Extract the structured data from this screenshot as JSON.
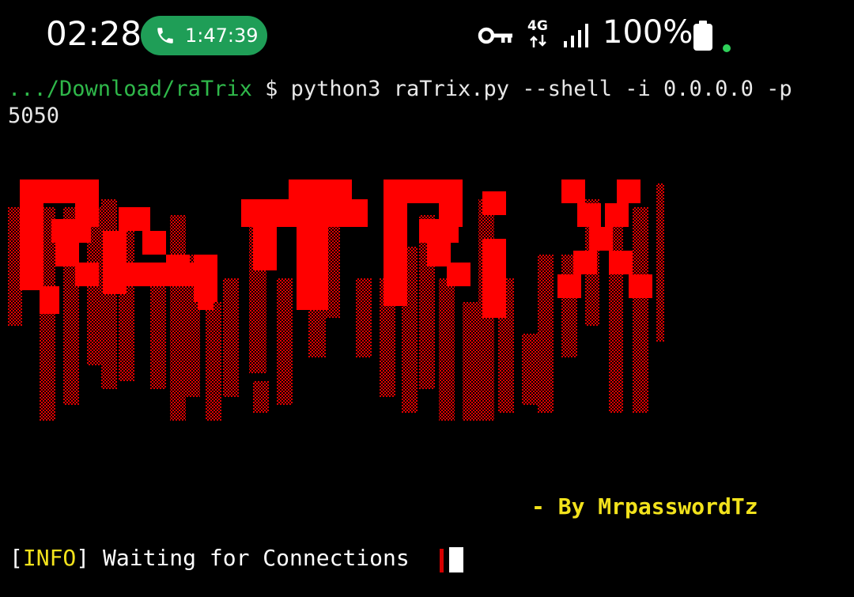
{
  "status_bar": {
    "time": "02:28",
    "call_duration": "1:47:39",
    "network_type": "4G",
    "battery_percent": "100%",
    "icons": [
      "phone-icon",
      "vpn-key-icon",
      "network-arrows-icon",
      "signal-icon",
      "battery-icon"
    ],
    "colors": {
      "call_pill": "#1f9e57",
      "privacy_dot": "#2fd15a"
    }
  },
  "terminal": {
    "prompt_path": ".../Download/raTrix",
    "prompt_sign": " $ ",
    "command_line1": "python3 raTrix.py --shell -i 0.0.0.0 -p",
    "command_line2": "5050",
    "banner_text": "raTrix",
    "author": "- By MrpasswordTz",
    "info_open": "[",
    "info_tag": "INFO",
    "info_close": "]",
    "info_message": " Waiting for Connections",
    "colors": {
      "prompt_path": "#2fb84a",
      "banner": "#ff0000",
      "author": "#f2e21c",
      "info_tag": "#f2e21c",
      "spinner": "#d40000"
    }
  }
}
